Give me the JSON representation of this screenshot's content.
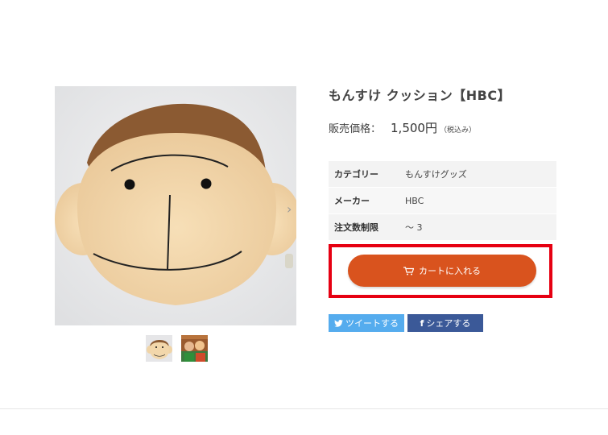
{
  "product": {
    "title": "もんすけ クッション【HBC】",
    "price_label": "販売価格：",
    "price": "1,500円",
    "tax_note": "（税込み）"
  },
  "specs": [
    {
      "key": "カテゴリー",
      "value": "もんすけグッズ"
    },
    {
      "key": "メーカー",
      "value": "HBC"
    },
    {
      "key": "注文数制限",
      "value": "～ 3"
    }
  ],
  "cart": {
    "label": "カートに入れる",
    "highlight_color": "#e60012",
    "button_color": "#d9531e"
  },
  "share": {
    "tweet_label": "ツイートする",
    "facebook_label": "シェアする",
    "tweet_color": "#55acee",
    "facebook_color": "#3b5998"
  },
  "gallery": {
    "next_arrow": "›",
    "thumbnail_count": 2
  }
}
